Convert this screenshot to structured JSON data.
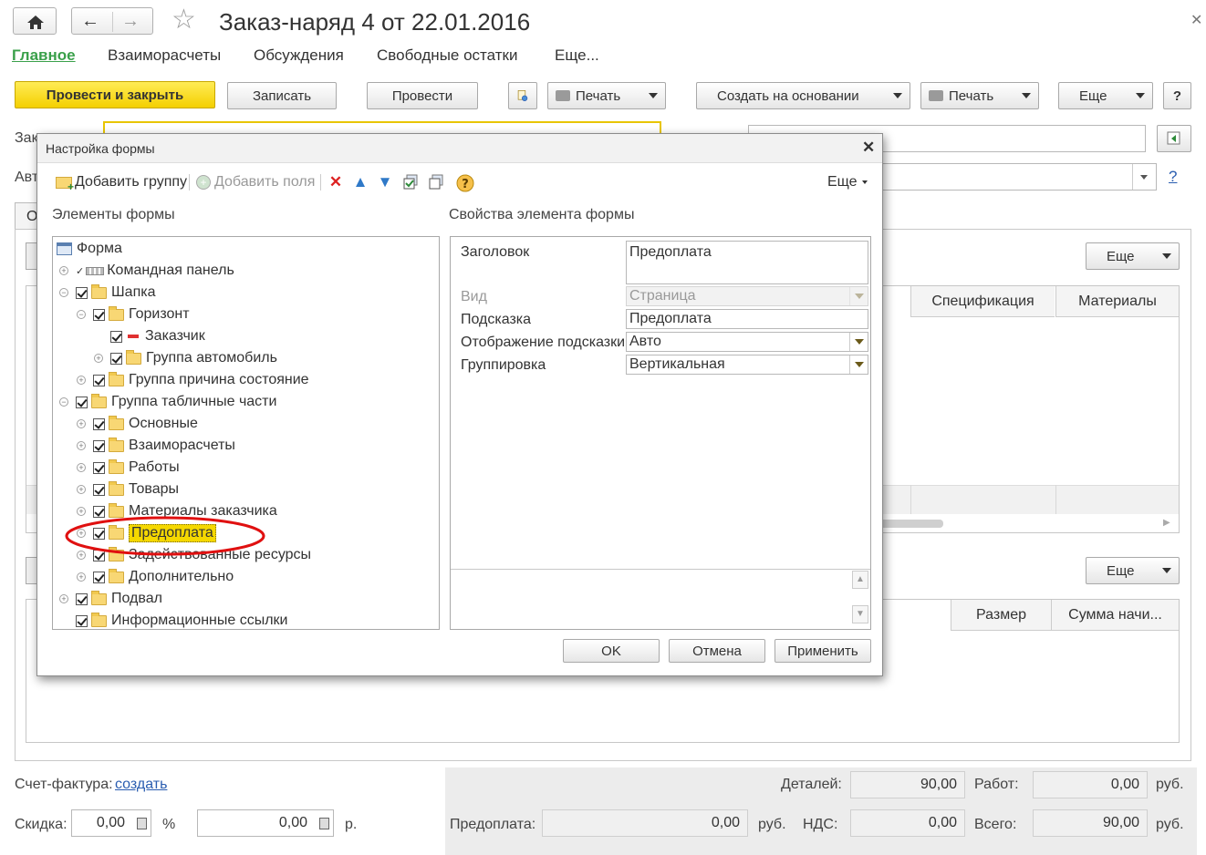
{
  "window": {
    "title": "Заказ-наряд 4 от 22.01.2016"
  },
  "nav": {
    "tabs": [
      "Главное",
      "Взаиморасчеты",
      "Обсуждения",
      "Свободные остатки",
      "Еще..."
    ]
  },
  "toolbar": {
    "post_close": "Провести и закрыть",
    "save": "Записать",
    "post": "Провести",
    "print": "Печать",
    "create_based": "Создать на основании",
    "print2": "Печать",
    "more": "Еще",
    "help": "?"
  },
  "form": {
    "customer_label_partial": "Зак",
    "auto_label_partial": "Авт",
    "tab_partial": "О",
    "grid_more": "Еще",
    "grid_cols": [
      "Спецификация",
      "Материалы"
    ],
    "grid2_more": "Еще",
    "grid2_cols": [
      "Размер",
      "Сумма начи..."
    ],
    "field_help": "?"
  },
  "dialog": {
    "title": "Настройка формы",
    "add_group": "Добавить группу",
    "add_fields": "Добавить поля",
    "more": "Еще",
    "left_caption": "Элементы формы",
    "right_caption": "Свойства элемента формы",
    "tree": [
      {
        "label": "Форма"
      },
      {
        "label": "Командная панель"
      },
      {
        "label": "Шапка"
      },
      {
        "label": "Горизонт"
      },
      {
        "label": "Заказчик"
      },
      {
        "label": "Группа автомобиль"
      },
      {
        "label": "Группа причина состояние"
      },
      {
        "label": "Группа табличные части"
      },
      {
        "label": "Основные"
      },
      {
        "label": "Взаиморасчеты"
      },
      {
        "label": "Работы"
      },
      {
        "label": "Товары"
      },
      {
        "label": "Материалы заказчика"
      },
      {
        "label": "Предоплата"
      },
      {
        "label": "Задействованные ресурсы"
      },
      {
        "label": "Дополнительно"
      },
      {
        "label": "Подвал"
      },
      {
        "label": "Информационные ссылки"
      }
    ],
    "props": {
      "title_label": "Заголовок",
      "title_value": "Предоплата",
      "view_label": "Вид",
      "view_value": "Страница",
      "hint_label": "Подсказка",
      "hint_value": "Предоплата",
      "hint_display_label": "Отображение подсказки",
      "hint_display_value": "Авто",
      "grouping_label": "Группировка",
      "grouping_value": "Вертикальная"
    },
    "ok": "OK",
    "cancel": "Отмена",
    "apply": "Применить"
  },
  "footer": {
    "invoice_label": "Счет-фактура:",
    "invoice_link": "создать",
    "discount_label": "Скидка:",
    "discount_value": "0,00",
    "percent": "%",
    "discount_sum": "0,00",
    "rub_short": "р.",
    "details_label": "Деталей:",
    "details_value": "90,00",
    "works_label": "Работ:",
    "works_value": "0,00",
    "rub": "руб.",
    "prepay_label": "Предоплата:",
    "prepay_value": "0,00",
    "vat_label": "НДС:",
    "vat_value": "0,00",
    "total_label": "Всего:",
    "total_value": "90,00"
  },
  "colors": {
    "accent_yellow": "#f4d000",
    "link_green": "#3aa04a",
    "highlight_red": "#e01010"
  }
}
